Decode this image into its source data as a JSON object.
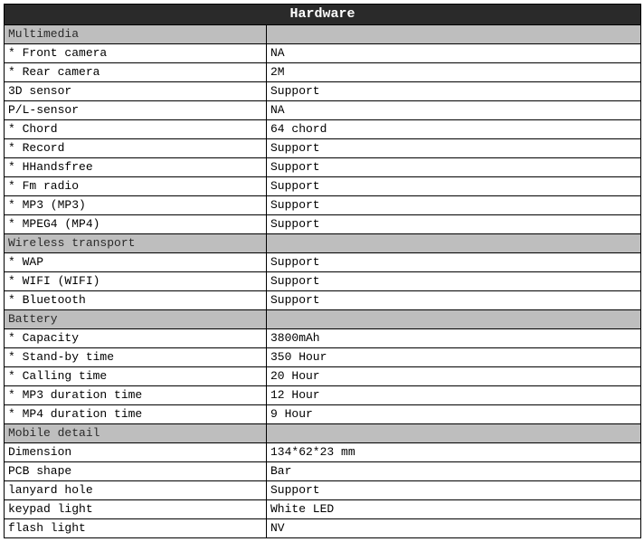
{
  "header": "Hardware",
  "sections": [
    {
      "title": "Multimedia",
      "rows": [
        {
          "label": "* Front camera",
          "value": "NA"
        },
        {
          "label": "* Rear camera",
          "value": "2M"
        },
        {
          "label": "3D sensor",
          "value": "Support"
        },
        {
          "label": "P/L-sensor",
          "value": "NA"
        },
        {
          "label": "* Chord",
          "value": "64 chord"
        },
        {
          "label": "* Record",
          "value": "Support"
        },
        {
          "label": "* HHandsfree",
          "value": "Support"
        },
        {
          "label": "* Fm radio",
          "value": "Support"
        },
        {
          "label": "* MP3 (MP3)",
          "value": "Support"
        },
        {
          "label": "* MPEG4 (MP4)",
          "value": "Support"
        }
      ]
    },
    {
      "title": "Wireless transport",
      "rows": [
        {
          "label": "* WAP",
          "value": "Support"
        },
        {
          "label": "* WIFI (WIFI)",
          "value": "Support"
        },
        {
          "label": "* Bluetooth",
          "value": "Support"
        }
      ]
    },
    {
      "title": "Battery",
      "rows": [
        {
          "label": "* Capacity",
          "value": "3800mAh"
        },
        {
          "label": "* Stand-by time",
          "value": "350 Hour"
        },
        {
          "label": "* Calling time",
          "value": "20 Hour"
        },
        {
          "label": "* MP3 duration time",
          "value": "12 Hour"
        },
        {
          "label": "* MP4 duration time",
          "value": "9 Hour"
        }
      ]
    },
    {
      "title": "Mobile detail",
      "rows": [
        {
          "label": "Dimension",
          "value": "134*62*23 mm"
        },
        {
          "label": "PCB shape",
          "value": "Bar"
        },
        {
          "label": "lanyard hole",
          "value": "Support"
        },
        {
          "label": "keypad light",
          "value": "White LED"
        },
        {
          "label": "flash light",
          "value": "NV"
        }
      ]
    }
  ]
}
